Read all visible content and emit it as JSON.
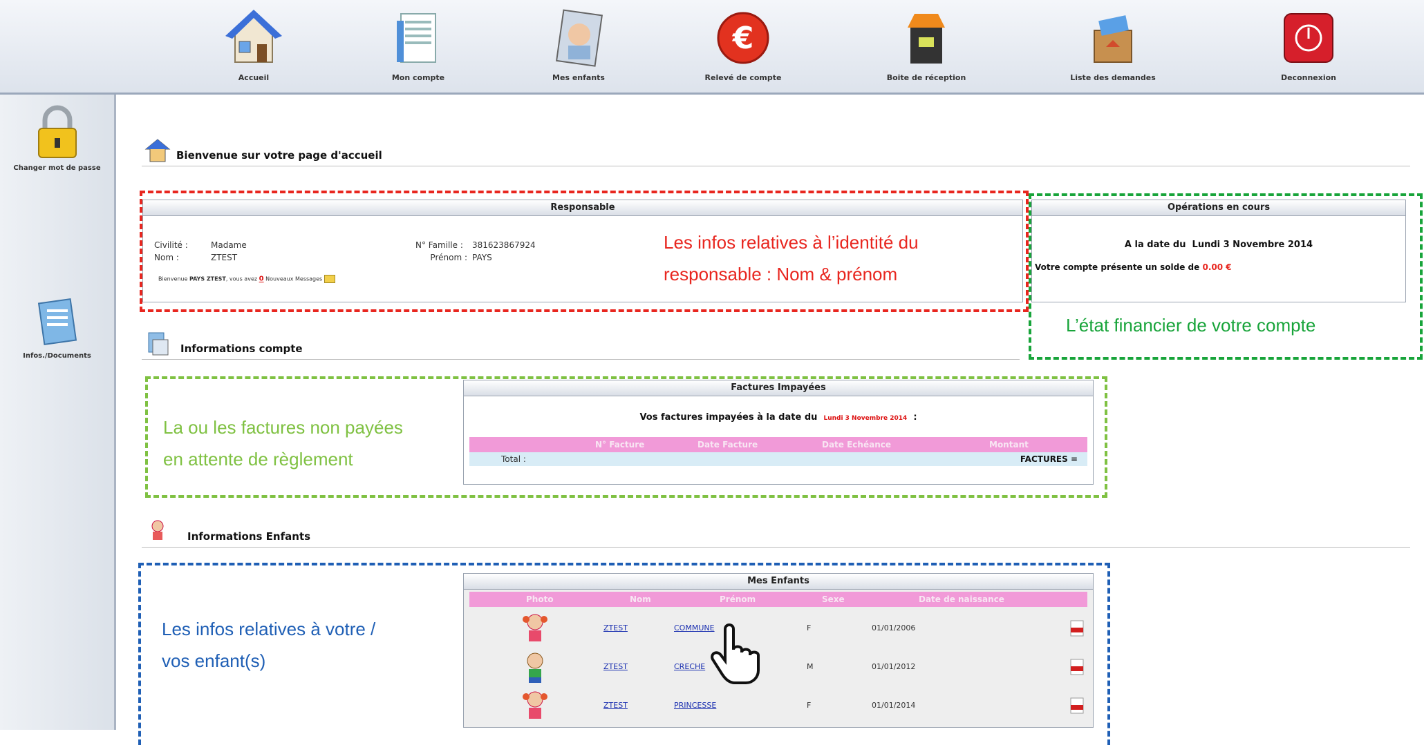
{
  "nav": [
    {
      "label": "Accueil",
      "icon": "home-icon"
    },
    {
      "label": "Mon compte",
      "icon": "account-document-icon"
    },
    {
      "label": "Mes enfants",
      "icon": "child-photo-icon"
    },
    {
      "label": "Relevé de compte",
      "icon": "euro-icon"
    },
    {
      "label": "Boite de réception",
      "icon": "inbox-icon"
    },
    {
      "label": "Liste des demandes",
      "icon": "requests-box-icon"
    },
    {
      "label": "Deconnexion",
      "icon": "power-icon"
    }
  ],
  "sidebar": [
    {
      "label": "Changer mot de passe",
      "icon": "padlock-icon"
    },
    {
      "label": "Infos./Documents",
      "icon": "documents-icon"
    }
  ],
  "sections": {
    "welcome": "Bienvenue sur votre page d'accueil",
    "account": "Informations compte",
    "children": "Informations Enfants"
  },
  "responsable": {
    "title": "Responsable",
    "civilite_label": "Civilité :",
    "civilite_value": "Madame",
    "nom_label": "Nom :",
    "nom_value": "ZTEST",
    "famille_label": "N° Famille :",
    "famille_value": "381623867924",
    "prenom_label": "Prénom :",
    "prenom_value": "PAYS",
    "bienvenue_prefix": "Bienvenue",
    "bienvenue_name": "PAYS ZTEST",
    "bienvenue_mid": ", vous avez",
    "messages_count": "0",
    "messages_suffix": "Nouveaux Messages"
  },
  "operations": {
    "title": "Opérations en cours",
    "date_prefix": "A la date du",
    "date": "Lundi 3 Novembre 2014",
    "solde_text": "Votre compte présente un solde de",
    "solde_value": "0.00 €"
  },
  "factures": {
    "title": "Factures Impayées",
    "intro": "Vos factures impayées à la date du",
    "date": "Lundi 3 Novembre 2014",
    "intro_suffix": ":",
    "columns": [
      "N° Facture",
      "Date Facture",
      "Date Echéance",
      "Montant"
    ],
    "total_label": "Total :",
    "total_value": "FACTURES ="
  },
  "enfants": {
    "title": "Mes Enfants",
    "columns": [
      "Photo",
      "Nom",
      "Prénom",
      "Sexe",
      "Date de naissance"
    ],
    "rows": [
      {
        "nom": "ZTEST",
        "prenom": "COMMUNE",
        "sexe": "F",
        "naissance": "01/01/2006"
      },
      {
        "nom": "ZTEST",
        "prenom": "CRECHE",
        "sexe": "M",
        "naissance": "01/01/2012"
      },
      {
        "nom": "ZTEST",
        "prenom": "PRINCESSE",
        "sexe": "F",
        "naissance": "01/01/2014"
      }
    ]
  },
  "annotations": {
    "identity_1": "Les infos relatives à l’identité du",
    "identity_2": "responsable : Nom & prénom",
    "financial": "L’état financier de votre compte",
    "invoices_1": "La ou les factures non payées",
    "invoices_2": "en attente de règlement",
    "children_1": "Les infos relatives à votre /",
    "children_2": "vos enfant(s)"
  },
  "colors": {
    "red_annot": "#e8261f",
    "green_annot": "#18a43a",
    "lime_annot": "#7fc142",
    "blue_annot": "#1f5fb5",
    "pink_header": "#f19ad8"
  }
}
